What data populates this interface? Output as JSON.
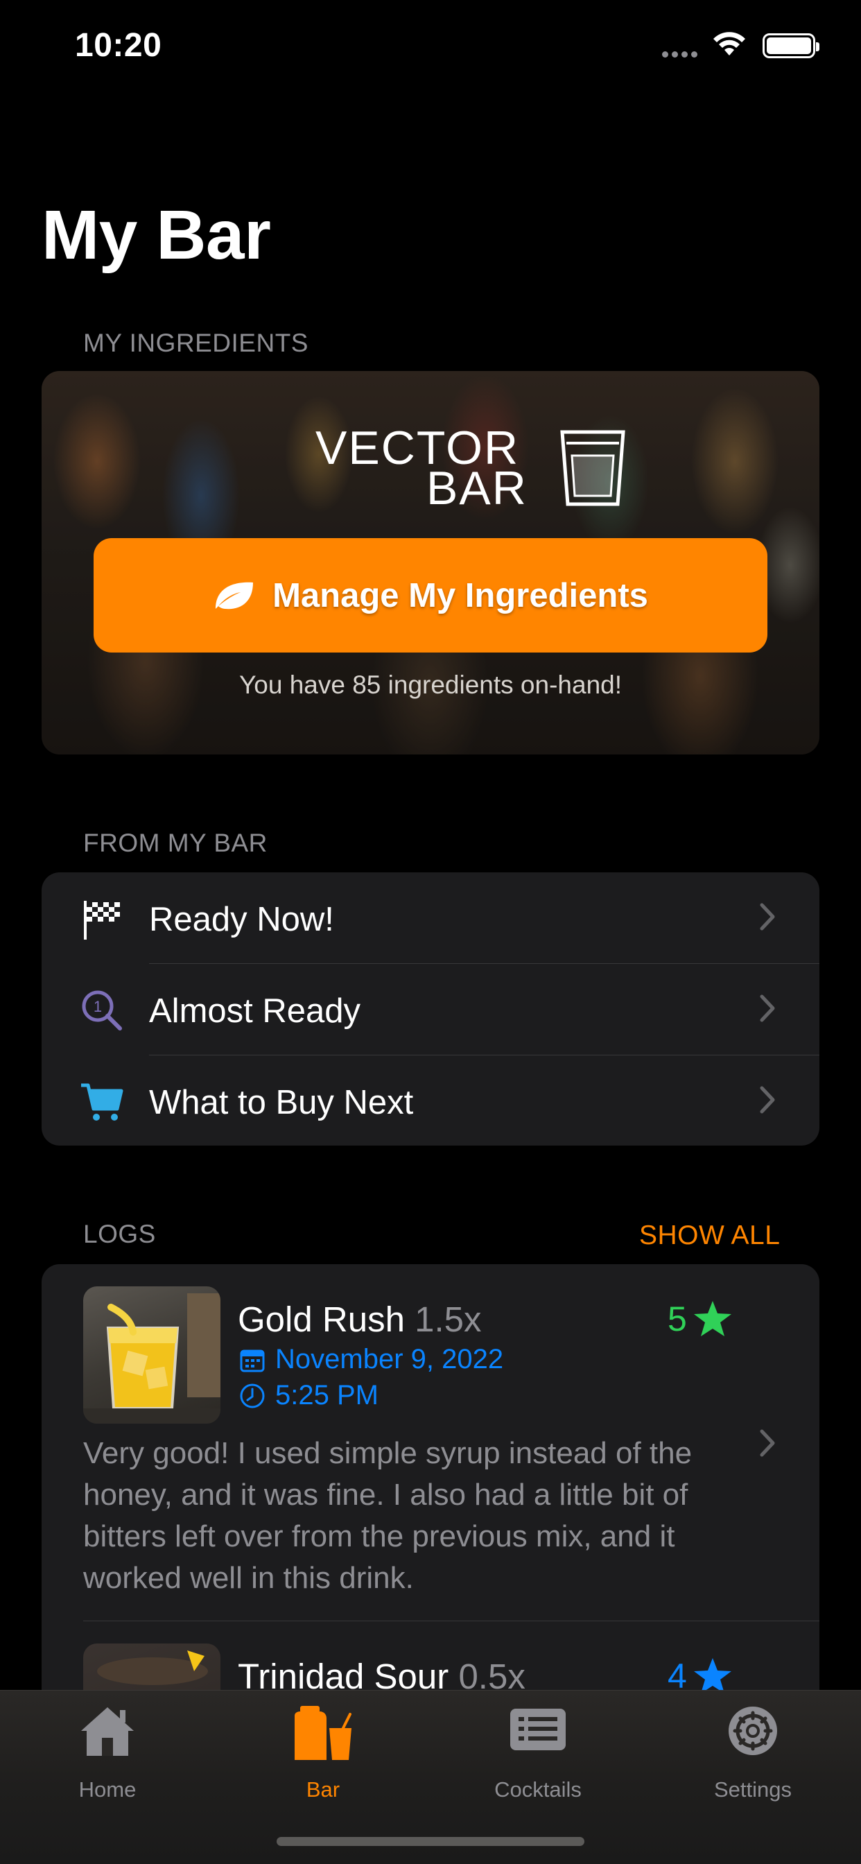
{
  "status_bar": {
    "time": "10:20"
  },
  "page": {
    "title": "My Bar"
  },
  "sections": {
    "ingredients_header": "MY INGREDIENTS",
    "from_bar_header": "FROM MY BAR",
    "logs_header": "LOGS",
    "show_all": "SHOW ALL"
  },
  "hero": {
    "logo_line1": "VECTOR",
    "logo_line2": "BAR",
    "button_label": "Manage My Ingredients",
    "ingredient_count_text": "You have 85 ingredients on-hand!",
    "button_color": "#ff8500"
  },
  "from_my_bar": [
    {
      "label": "Ready Now!",
      "icon": "checkered-flag-icon"
    },
    {
      "label": "Almost Ready",
      "icon": "magnifier-one-icon",
      "color": "#7d6fb8"
    },
    {
      "label": "What to Buy Next",
      "icon": "cart-icon",
      "color": "#32ade6"
    }
  ],
  "logs": [
    {
      "name": "Gold Rush",
      "multiplier": "1.5x",
      "rating": "5",
      "rating_color": "#30d158",
      "date": "November 9, 2022",
      "time": "5:25 PM",
      "note": "Very good! I used simple syrup instead of the honey, and it was fine. I also had a little bit of bitters left over from the previous mix, and it worked well in this drink."
    },
    {
      "name": "Trinidad Sour",
      "multiplier": "0.5x",
      "rating": "4",
      "rating_color": "#0a84ff"
    }
  ],
  "tabs": [
    {
      "label": "Home",
      "icon": "home-icon",
      "active": false
    },
    {
      "label": "Bar",
      "icon": "bar-icon",
      "active": true
    },
    {
      "label": "Cocktails",
      "icon": "cocktails-list-icon",
      "active": false
    },
    {
      "label": "Settings",
      "icon": "gear-icon",
      "active": false
    }
  ],
  "colors": {
    "accent": "#ff8500",
    "link": "#0a84ff",
    "secondary_text": "#8e8e93"
  }
}
